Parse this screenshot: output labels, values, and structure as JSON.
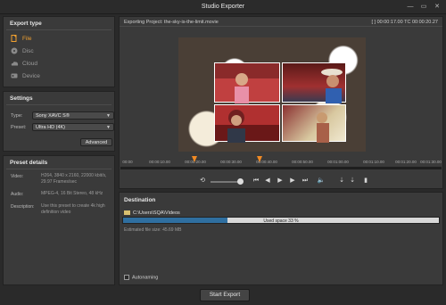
{
  "window": {
    "title": "Studio Exporter",
    "controls": [
      "—",
      "▭",
      "✕"
    ]
  },
  "export_type": {
    "title": "Export type",
    "items": [
      {
        "label": "File",
        "icon": "file-icon",
        "active": true
      },
      {
        "label": "Disc",
        "icon": "disc-icon",
        "active": false
      },
      {
        "label": "Cloud",
        "icon": "cloud-icon",
        "active": false
      },
      {
        "label": "Device",
        "icon": "device-icon",
        "active": false
      }
    ]
  },
  "settings": {
    "title": "Settings",
    "type_label": "Type:",
    "type_value": "Sony XAVC S®",
    "preset_label": "Preset:",
    "preset_value": "Ultra HD (4K)",
    "advanced_label": "Advanced"
  },
  "preset_details": {
    "title": "Preset details",
    "video_label": "Video:",
    "video_value": "H264, 3840 x 2160, 22000 kbit/s, 29.97 Frames/sec",
    "audio_label": "Audio:",
    "audio_value": "MPEG-4, 16 Bit Stereo, 48 kHz",
    "description_label": "Description:",
    "description_value": "Use this preset to create 4k high definition video"
  },
  "preview": {
    "project": "Exporting Project: the-sky-is-the-limit.movie",
    "timecode": "[ ] 00:00:17.00   TC 00:00:20.27"
  },
  "timeline": {
    "ticks": [
      "00:00",
      "00:00:10.00",
      "00:00:20.00",
      "00:00:30.00",
      "00:00:40.00",
      "00:00:50.00",
      "00:01:00.00",
      "00:01:10.00",
      "00:01:20.00",
      "00:01:30.00"
    ]
  },
  "destination": {
    "title": "Destination",
    "folder": "C:\\Users\\SQA\\Videos",
    "used_space": "Used space 33 %",
    "used_fraction": 0.33,
    "estimated_size": "Estimated file size: 45.69 MB",
    "autonaming": "Autonaming"
  },
  "start_export": "Start Export",
  "colors": {
    "accent": "#f08a24",
    "bar": "#2f6fa0",
    "panel": "#3a3a3a"
  }
}
